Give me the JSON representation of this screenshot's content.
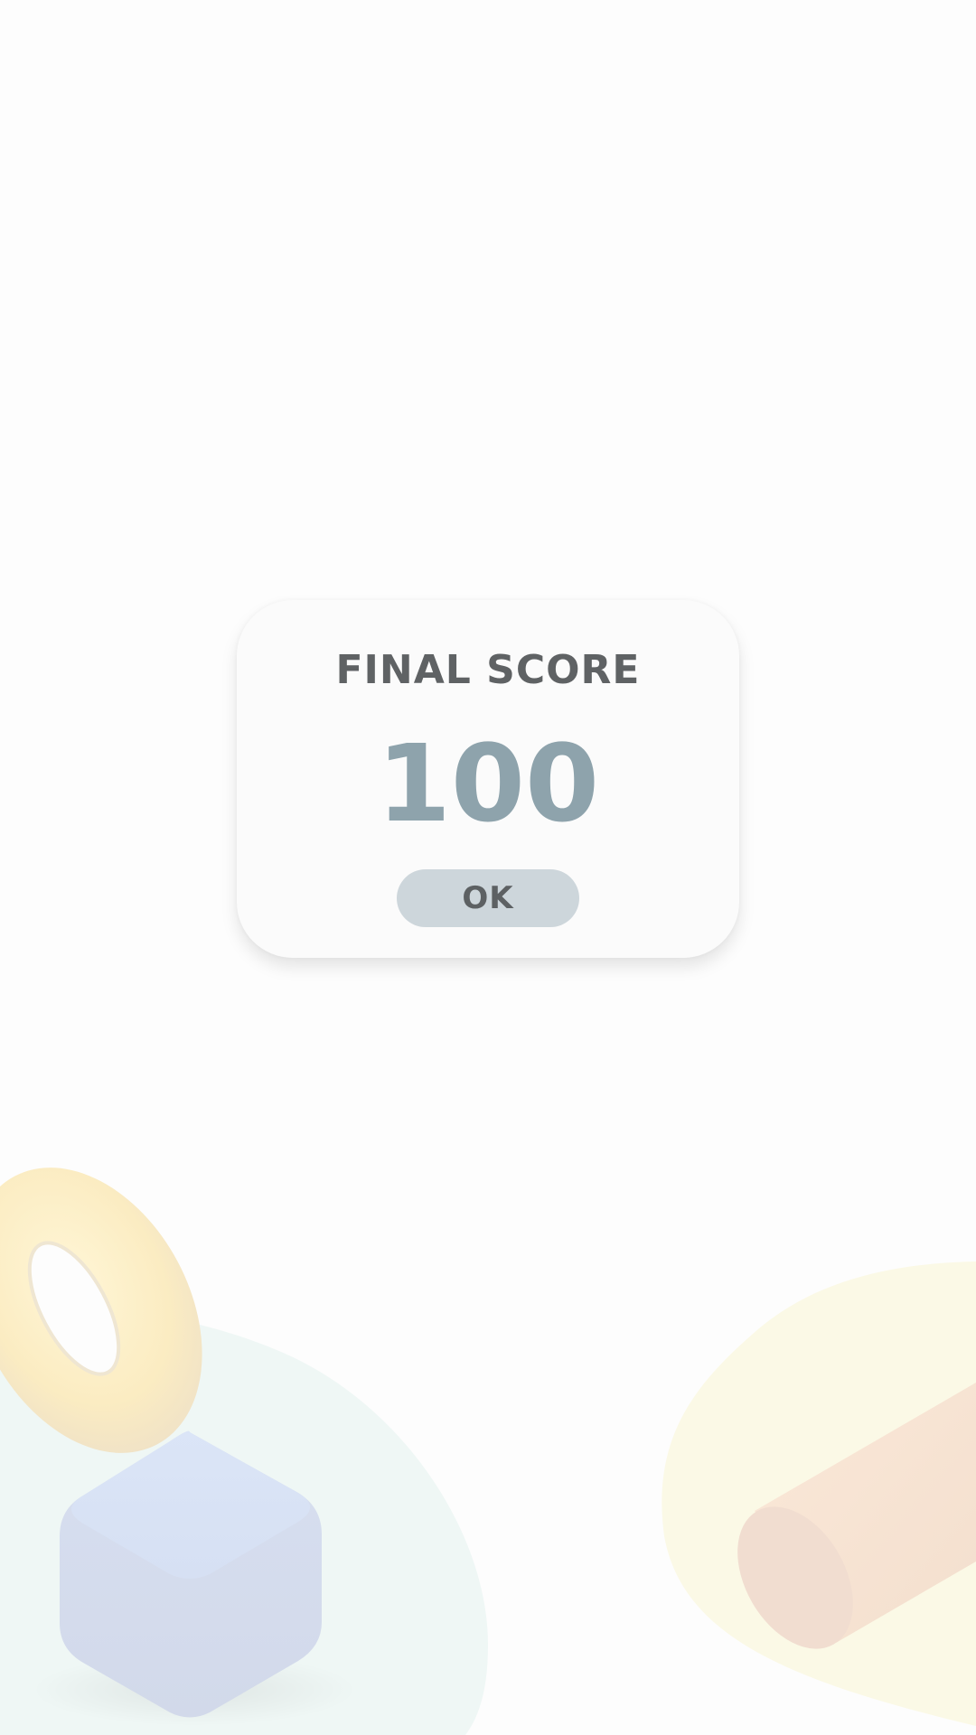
{
  "dialog": {
    "title": "FINAL SCORE",
    "score": "100",
    "ok_label": "OK"
  },
  "colors": {
    "background": "#fdfdfd",
    "card": "#fbfbfb",
    "title_text": "#5f6264",
    "score_text": "#8ea3ac",
    "button_fill": "#cdd6db",
    "button_text": "#5d6163"
  },
  "decorations": [
    "torus-shape",
    "cube-shape",
    "cylinder-shape",
    "mint-blob",
    "cream-blob"
  ]
}
